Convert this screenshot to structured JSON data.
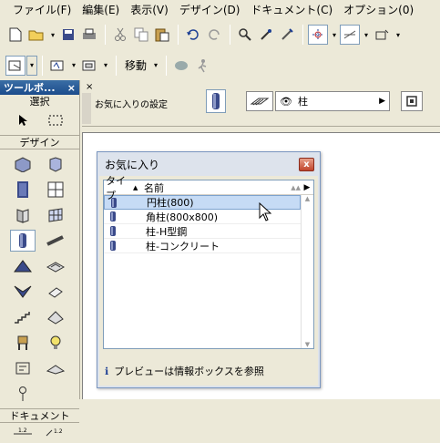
{
  "menu": [
    "ファイル(F)",
    "編集(E)",
    "表示(V)",
    "デザイン(D)",
    "ドキュメント(C)",
    "オプション(0)"
  ],
  "toolbar2": {
    "move_label": "移動"
  },
  "toolbox": {
    "title": "ツールボ...",
    "close": "×",
    "section_select": "選択",
    "section_design": "デザイン",
    "section_document": "ドキュメント"
  },
  "infobox": {
    "favorites_settings": "お気に入りの設定",
    "layer_value": "柱"
  },
  "favorites": {
    "title": "お気に入り",
    "close": "x",
    "col_type": "タイプ",
    "col_name": "名前",
    "items": [
      "円柱(800)",
      "角柱(800x800)",
      "柱-H型鋼",
      "柱-コンクリート"
    ],
    "selected_index": 0,
    "note": "プレビューは情報ボックスを参照"
  },
  "colors": {
    "accent": "#316ac5",
    "toolbox_header": "#3a6ea5",
    "selection": "#c6dbf5"
  }
}
